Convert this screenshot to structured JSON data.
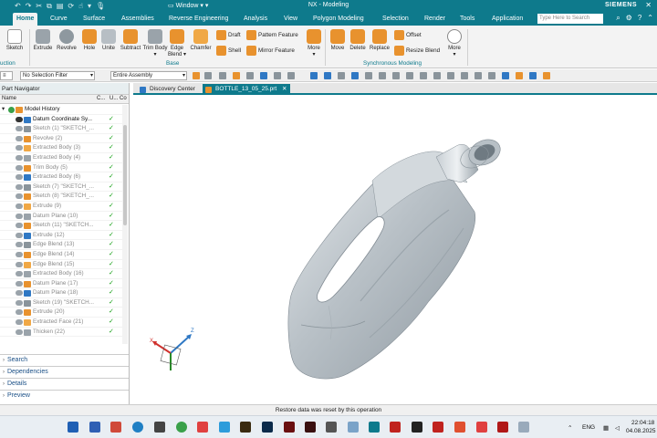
{
  "window": {
    "app_title": "NX - Modeling",
    "brand": "SIEMENS",
    "window_menu": "Window"
  },
  "menu": {
    "tabs": [
      "Home",
      "Curve",
      "Surface",
      "Assemblies",
      "Reverse Engineering",
      "Analysis",
      "View",
      "Polygon Modeling",
      "Selection",
      "Render",
      "Tools",
      "Application"
    ],
    "active_tab": "Home",
    "search_placeholder": "Type Here to Search"
  },
  "ribbon": {
    "sketch_label": "Sketch",
    "construction_group": "uction",
    "base_buttons": [
      "Extrude",
      "Revolve",
      "Hole",
      "Unite",
      "Subtract",
      "Trim Body",
      "Edge Blend",
      "Chamfer"
    ],
    "draft": "Draft",
    "shell": "Shell",
    "pattern_feature": "Pattern Feature",
    "mirror_feature": "Mirror Feature",
    "more": "More",
    "base_group": "Base",
    "sync_buttons": [
      "Move",
      "Delete",
      "Replace"
    ],
    "offset": "Offset",
    "resize_blend": "Resize Blend",
    "sync_group": "Synchronous Modeling",
    "colors": {
      "orange": "#e8922e",
      "blue": "#2f78c4",
      "gray": "#9aa3aa",
      "teal": "#0e7a8c"
    }
  },
  "selection_bar": {
    "filter": "No Selection Filter",
    "scope": "Entire Assembly"
  },
  "navigator": {
    "title": "Part Navigator",
    "col_name": "Name",
    "col_c": "C...",
    "col_u": "U...",
    "col_co": "Co",
    "items": [
      {
        "label": "Model History",
        "dark": true,
        "check": false
      },
      {
        "label": "Datum Coordinate Sy...",
        "dark": true,
        "check": true
      },
      {
        "label": "Sketch (1) \"SKETCH_...",
        "dark": false,
        "check": true
      },
      {
        "label": "Revolve (2)",
        "dark": false,
        "check": true
      },
      {
        "label": "Extracted Body (3)",
        "dark": false,
        "check": true
      },
      {
        "label": "Extracted Body (4)",
        "dark": false,
        "check": true
      },
      {
        "label": "Trim Body (5)",
        "dark": false,
        "check": true
      },
      {
        "label": "Extracted Body (6)",
        "dark": false,
        "check": true
      },
      {
        "label": "Sketch (7) \"SKETCH_...",
        "dark": false,
        "check": true
      },
      {
        "label": "Sketch (8) \"SKETCH_...",
        "dark": false,
        "check": true
      },
      {
        "label": "Extrude (9)",
        "dark": false,
        "check": true
      },
      {
        "label": "Datum Plane (10)",
        "dark": false,
        "check": true
      },
      {
        "label": "Sketch (11) \"SKETCH...",
        "dark": false,
        "check": true
      },
      {
        "label": "Extrude (12)",
        "dark": false,
        "check": true
      },
      {
        "label": "Edge Blend (13)",
        "dark": false,
        "check": true
      },
      {
        "label": "Edge Blend (14)",
        "dark": false,
        "check": true
      },
      {
        "label": "Edge Blend (15)",
        "dark": false,
        "check": true
      },
      {
        "label": "Extracted Body (16)",
        "dark": false,
        "check": true
      },
      {
        "label": "Datum Plane (17)",
        "dark": false,
        "check": true
      },
      {
        "label": "Datum Plane (18)",
        "dark": false,
        "check": true
      },
      {
        "label": "Sketch (19) \"SKETCH...",
        "dark": false,
        "check": true
      },
      {
        "label": "Extrude (20)",
        "dark": false,
        "check": true
      },
      {
        "label": "Extracted Face (21)",
        "dark": false,
        "check": true
      },
      {
        "label": "Thicken (22)",
        "dark": false,
        "check": true
      }
    ],
    "panels": [
      "Search",
      "Dependencies",
      "Details",
      "Preview"
    ]
  },
  "doc_tabs": {
    "discovery": "Discovery Center",
    "part": "BOTTLE_13_05_25.prt",
    "close": "✕"
  },
  "status": "Restore data was reset by this operation",
  "taskbar": {
    "lang": "ENG",
    "time": "22:04:18",
    "date": "04.08.2025"
  }
}
